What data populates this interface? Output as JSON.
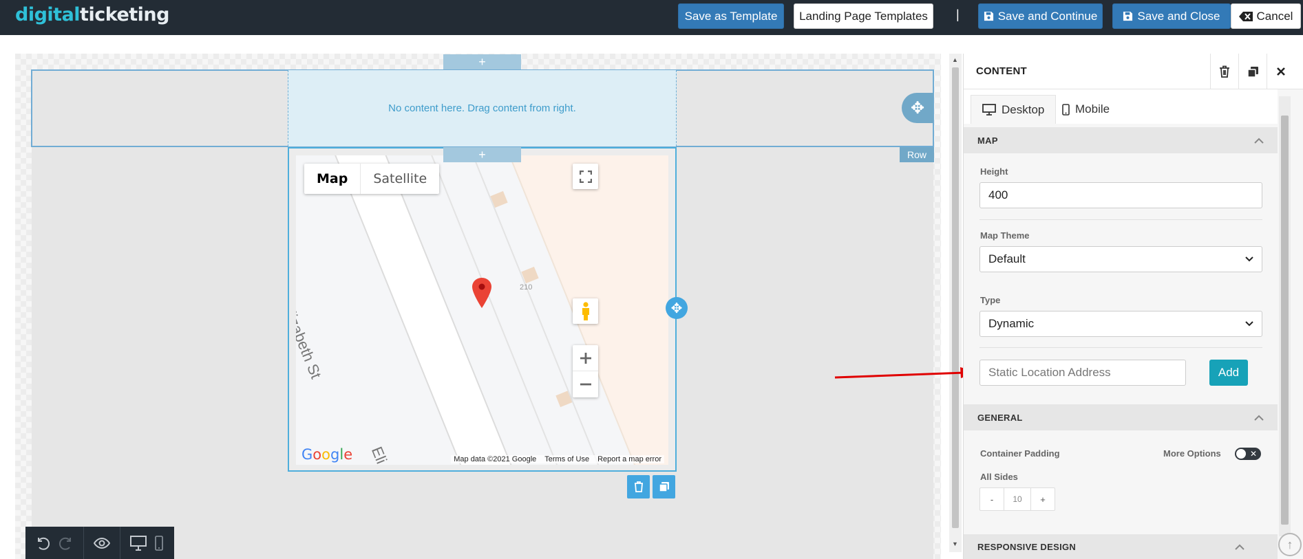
{
  "header": {
    "logo_part1": "digital",
    "logo_part2": "ticketing",
    "save_as_template": "Save as Template",
    "landing_page_templates": "Landing Page Templates",
    "separator": "|",
    "save_and_continue": "Save and Continue",
    "save_and_close": "Save and Close",
    "cancel": "Cancel"
  },
  "canvas": {
    "empty_message": "No content here. Drag content from right.",
    "add_symbol": "+",
    "row_label": "Row"
  },
  "map": {
    "type_map": "Map",
    "type_satellite": "Satellite",
    "street_name": "Elizabeth St",
    "street_name_partial": "Eli",
    "building_number": "210",
    "google_logo": "Google",
    "attribution": {
      "map_data": "Map data ©2021 Google",
      "terms": "Terms of Use",
      "report": "Report a map error"
    }
  },
  "panel": {
    "title": "CONTENT",
    "tabs": [
      {
        "label": "Desktop",
        "active": true
      },
      {
        "label": "Mobile",
        "active": false
      }
    ],
    "map_section": {
      "header": "MAP",
      "height_label": "Height",
      "height_value": "400",
      "theme_label": "Map Theme",
      "theme_value": "Default",
      "type_label": "Type",
      "type_value": "Dynamic",
      "address_placeholder": "Static Location Address",
      "add_button": "Add"
    },
    "general_section": {
      "header": "GENERAL",
      "container_padding_label": "Container Padding",
      "more_options_label": "More Options",
      "all_sides_label": "All Sides",
      "minus": "-",
      "padding_value": "10",
      "plus": "+"
    },
    "responsive_section": {
      "header": "RESPONSIVE DESIGN"
    }
  },
  "colors": {
    "topbar": "#232c35",
    "primary_blue": "#337ab7",
    "teal": "#17a2b8",
    "drop_zone": "#ddeef6",
    "selection": "#4eaedc",
    "annotation_arrow": "#e00000"
  }
}
